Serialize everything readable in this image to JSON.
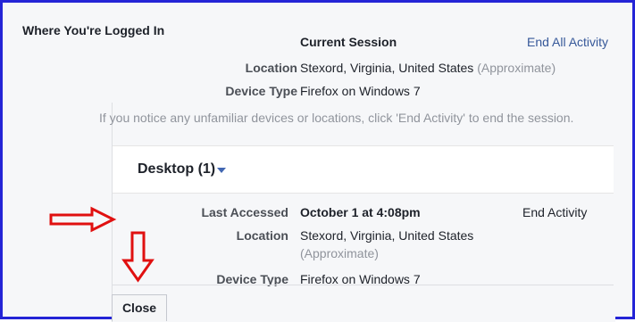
{
  "section_title": "Where You're Logged In",
  "current_session": {
    "label": "Current Session",
    "end_all_link": "End All Activity",
    "location_label": "Location",
    "location_value": "Stexord, Virginia, United States",
    "location_note": "(Approximate)",
    "device_type_label": "Device Type",
    "device_type_value": "Firefox on Windows 7"
  },
  "notice_text": "If you notice any unfamiliar devices or locations, click 'End Activity' to end the session.",
  "desktop": {
    "title": "Desktop",
    "count": "(1)",
    "last_accessed_label": "Last Accessed",
    "last_accessed_value": "October 1 at 4:08pm",
    "end_activity_link": "End Activity",
    "location_label": "Location",
    "location_value": "Stexord, Virginia, United States",
    "location_note": "(Approximate)",
    "device_type_label": "Device Type",
    "device_type_value": "Firefox on Windows 7"
  },
  "close_button": "Close",
  "colors": {
    "link": "#365899",
    "muted": "#90949c",
    "frame_border": "#2424d6",
    "annotation_arrow": "#e01010"
  },
  "icons": {
    "caret": "chevron-down-icon",
    "annotation_right": "arrow-right-icon",
    "annotation_down": "arrow-down-icon"
  }
}
